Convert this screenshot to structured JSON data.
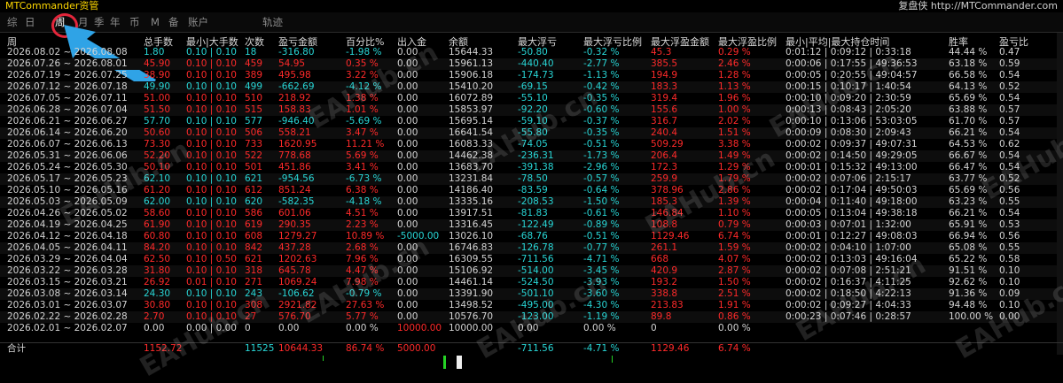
{
  "window": {
    "title": "MTCommander资管",
    "website": "复盘侠 http://MTCommander.com"
  },
  "tabs": [
    "综",
    "日",
    "周",
    "月",
    "季",
    "年",
    "币",
    "M",
    "备",
    "账户",
    "轨迹"
  ],
  "active_tab": "周",
  "columns": [
    "周",
    "总手数",
    "最小|大手数",
    "次数",
    "盈亏金额",
    "百分比%",
    "出入金",
    "余额",
    "最大浮亏",
    "最大浮亏比例",
    "最大浮盈金额",
    "最大浮盈比例",
    "最小|平均|最大持仓时间",
    "胜率",
    "盈亏比"
  ],
  "rows": [
    [
      "2026.08.02 ~ 2026.08.08",
      "1.80",
      "0.10 | 0.10",
      "18",
      "-316.80",
      "-1.98 %",
      "0.00",
      "15644.33",
      "-50.80",
      "-0.32 %",
      "45.3",
      "0.29 %",
      "0:01:12 | 0:09:12 | 0:33:18",
      "44.44 %",
      "0.47"
    ],
    [
      "2026.07.26 ~ 2026.08.01",
      "45.90",
      "0.10 | 0.10",
      "459",
      "54.95",
      "0.35 %",
      "0.00",
      "15961.13",
      "-440.40",
      "-2.77 %",
      "385.5",
      "2.46 %",
      "0:00:06 | 0:17:55 | 49:36:53",
      "63.18 %",
      "0.59"
    ],
    [
      "2026.07.19 ~ 2026.07.25",
      "38.90",
      "0.10 | 0.10",
      "389",
      "495.98",
      "3.22 %",
      "0.00",
      "15906.18",
      "-174.73",
      "-1.13 %",
      "194.9",
      "1.28 %",
      "0:00:05 | 0:20:55 | 49:04:57",
      "66.58 %",
      "0.54"
    ],
    [
      "2026.07.12 ~ 2026.07.18",
      "49.90",
      "0.10 | 0.10",
      "499",
      "-662.69",
      "-4.12 %",
      "0.00",
      "15410.20",
      "-69.15",
      "-0.42 %",
      "183.3",
      "1.13 %",
      "0:00:15 | 0:10:17 | 1:40:54",
      "64.13 %",
      "0.52"
    ],
    [
      "2026.07.05 ~ 2026.07.11",
      "51.00",
      "0.10 | 0.10",
      "510",
      "218.92",
      "1.38 %",
      "0.00",
      "16072.89",
      "-55.10",
      "-0.35 %",
      "319.4",
      "1.96 %",
      "0:00:10 | 0:09:20 | 2:30:59",
      "65.69 %",
      "0.54"
    ],
    [
      "2026.06.28 ~ 2026.07.04",
      "51.50",
      "0.10 | 0.10",
      "515",
      "158.83",
      "1.01 %",
      "0.00",
      "15853.97",
      "-92.20",
      "-0.60 %",
      "155.6",
      "1.00 %",
      "0:00:13 | 0:08:43 | 2:05:20",
      "63.88 %",
      "0.57"
    ],
    [
      "2026.06.21 ~ 2026.06.27",
      "57.70",
      "0.10 | 0.10",
      "577",
      "-946.40",
      "-5.69 %",
      "0.00",
      "15695.14",
      "-59.10",
      "-0.37 %",
      "316.7",
      "2.02 %",
      "0:00:10 | 0:13:06 | 53:03:05",
      "61.70 %",
      "0.57"
    ],
    [
      "2026.06.14 ~ 2026.06.20",
      "50.60",
      "0.10 | 0.10",
      "506",
      "558.21",
      "3.47 %",
      "0.00",
      "16641.54",
      "-55.80",
      "-0.35 %",
      "240.4",
      "1.51 %",
      "0:00:09 | 0:08:30 | 2:09:43",
      "66.21 %",
      "0.54"
    ],
    [
      "2026.06.07 ~ 2026.06.13",
      "73.30",
      "0.10 | 0.10",
      "733",
      "1620.95",
      "11.21 %",
      "0.00",
      "16083.33",
      "-74.05",
      "-0.51 %",
      "509.29",
      "3.38 %",
      "0:00:02 | 0:09:37 | 49:07:31",
      "64.53 %",
      "0.62"
    ],
    [
      "2026.05.31 ~ 2026.06.06",
      "52.20",
      "0.10 | 0.10",
      "522",
      "778.68",
      "5.69 %",
      "0.00",
      "14462.38",
      "-236.31",
      "-1.73 %",
      "206.4",
      "1.49 %",
      "0:00:02 | 0:14:50 | 49:29:05",
      "66.67 %",
      "0.54"
    ],
    [
      "2026.05.24 ~ 2026.05.30",
      "50.10",
      "0.10 | 0.10",
      "501",
      "451.86",
      "3.41 %",
      "0.00",
      "13683.70",
      "-391.38",
      "-2.96 %",
      "172.3",
      "1.29 %",
      "0:00:01 | 0:15:32 | 49:13:00",
      "66.47 %",
      "0.54"
    ],
    [
      "2026.05.17 ~ 2026.05.23",
      "62.10",
      "0.10 | 0.10",
      "621",
      "-954.56",
      "-6.73 %",
      "0.00",
      "13231.84",
      "-78.50",
      "-0.57 %",
      "259.9",
      "1.79 %",
      "0:00:02 | 0:07:06 | 2:15:17",
      "63.77 %",
      "0.52"
    ],
    [
      "2026.05.10 ~ 2026.05.16",
      "61.20",
      "0.10 | 0.10",
      "612",
      "851.24",
      "6.38 %",
      "0.00",
      "14186.40",
      "-83.59",
      "-0.64 %",
      "378.96",
      "2.86 %",
      "0:00:02 | 0:17:04 | 49:50:03",
      "65.69 %",
      "0.56"
    ],
    [
      "2026.05.03 ~ 2026.05.09",
      "62.00",
      "0.10 | 0.10",
      "620",
      "-582.35",
      "-4.18 %",
      "0.00",
      "13335.16",
      "-208.53",
      "-1.50 %",
      "185.3",
      "1.39 %",
      "0:00:04 | 0:11:40 | 49:18:00",
      "63.23 %",
      "0.55"
    ],
    [
      "2026.04.26 ~ 2026.05.02",
      "58.60",
      "0.10 | 0.10",
      "586",
      "601.06",
      "4.51 %",
      "0.00",
      "13917.51",
      "-81.83",
      "-0.61 %",
      "146.84",
      "1.10 %",
      "0:00:05 | 0:13:04 | 49:38:18",
      "66.21 %",
      "0.54"
    ],
    [
      "2026.04.19 ~ 2026.04.25",
      "61.90",
      "0.10 | 0.10",
      "619",
      "290.35",
      "2.23 %",
      "0.00",
      "13316.45",
      "-122.49",
      "-0.89 %",
      "108.8",
      "0.79 %",
      "0:00:03 | 0:07:01 | 1:32:00",
      "65.91 %",
      "0.53"
    ],
    [
      "2026.04.12 ~ 2026.04.18",
      "60.80",
      "0.10 | 0.10",
      "608",
      "1279.27",
      "10.89 %",
      "-5000.00",
      "13026.10",
      "-68.76",
      "-0.51 %",
      "1129.46",
      "6.74 %",
      "0:00:01 | 0:12:27 | 49:08:03",
      "66.94 %",
      "0.56"
    ],
    [
      "2026.04.05 ~ 2026.04.11",
      "84.20",
      "0.10 | 0.10",
      "842",
      "437.28",
      "2.68 %",
      "0.00",
      "16746.83",
      "-126.78",
      "-0.77 %",
      "261.1",
      "1.59 %",
      "0:00:02 | 0:04:10 | 1:07:00",
      "65.08 %",
      "0.55"
    ],
    [
      "2026.03.29 ~ 2026.04.04",
      "62.50",
      "0.10 | 0.50",
      "621",
      "1202.63",
      "7.96 %",
      "0.00",
      "16309.55",
      "-711.56",
      "-4.71 %",
      "668",
      "4.07 %",
      "0:00:02 | 0:13:03 | 49:16:04",
      "65.22 %",
      "0.58"
    ],
    [
      "2026.03.22 ~ 2026.03.28",
      "31.80",
      "0.10 | 0.10",
      "318",
      "645.78",
      "4.47 %",
      "0.00",
      "15106.92",
      "-514.00",
      "-3.45 %",
      "420.9",
      "2.87 %",
      "0:00:02 | 0:07:08 | 2:51:21",
      "91.51 %",
      "0.10"
    ],
    [
      "2026.03.15 ~ 2026.03.21",
      "26.92",
      "0.01 | 0.10",
      "271",
      "1069.24",
      "7.98 %",
      "0.00",
      "14461.14",
      "-524.50",
      "-3.93 %",
      "193.2",
      "1.50 %",
      "0:00:02 | 0:16:37 | 4:11:25",
      "92.62 %",
      "0.10"
    ],
    [
      "2026.03.08 ~ 2026.03.14",
      "24.30",
      "0.10 | 0.10",
      "243",
      "-106.62",
      "-0.79 %",
      "0.00",
      "13391.90",
      "-501.10",
      "-3.60 %",
      "338.8",
      "2.51 %",
      "0:00:02 | 0:18:50 | 4:22:13",
      "91.36 %",
      "0.09"
    ],
    [
      "2026.03.01 ~ 2026.03.07",
      "30.80",
      "0.10 | 0.10",
      "308",
      "2921.82",
      "27.63 %",
      "0.00",
      "13498.52",
      "-495.00",
      "-4.30 %",
      "213.83",
      "1.91 %",
      "0:00:02 | 0:09:27 | 4:04:33",
      "94.48 %",
      "0.10"
    ],
    [
      "2026.02.22 ~ 2026.02.28",
      "2.70",
      "0.10 | 0.10",
      "27",
      "576.70",
      "5.77 %",
      "0.00",
      "10576.70",
      "-123.00",
      "-1.19 %",
      "89.8",
      "0.86 %",
      "0:00:23 | 0:07:46 | 0:28:57",
      "100.00 %",
      "0.00"
    ],
    [
      "2026.02.01 ~ 2026.02.07",
      "0.00",
      "0.00 | 0.00",
      "0",
      "0.00",
      "0.00 %",
      "10000.00",
      "10000.00",
      "0.00",
      "0.00 %",
      "0",
      "0.00 %",
      "",
      "",
      ""
    ]
  ],
  "totals": [
    "合计",
    "1152.72",
    "",
    "11525",
    "10644.33",
    "86.74 %",
    "5000.00",
    "",
    "-711.56",
    "-4.71 %",
    "1129.46",
    "6.74 %",
    "",
    "",
    ""
  ],
  "watermark_text": "EAHub.cn"
}
